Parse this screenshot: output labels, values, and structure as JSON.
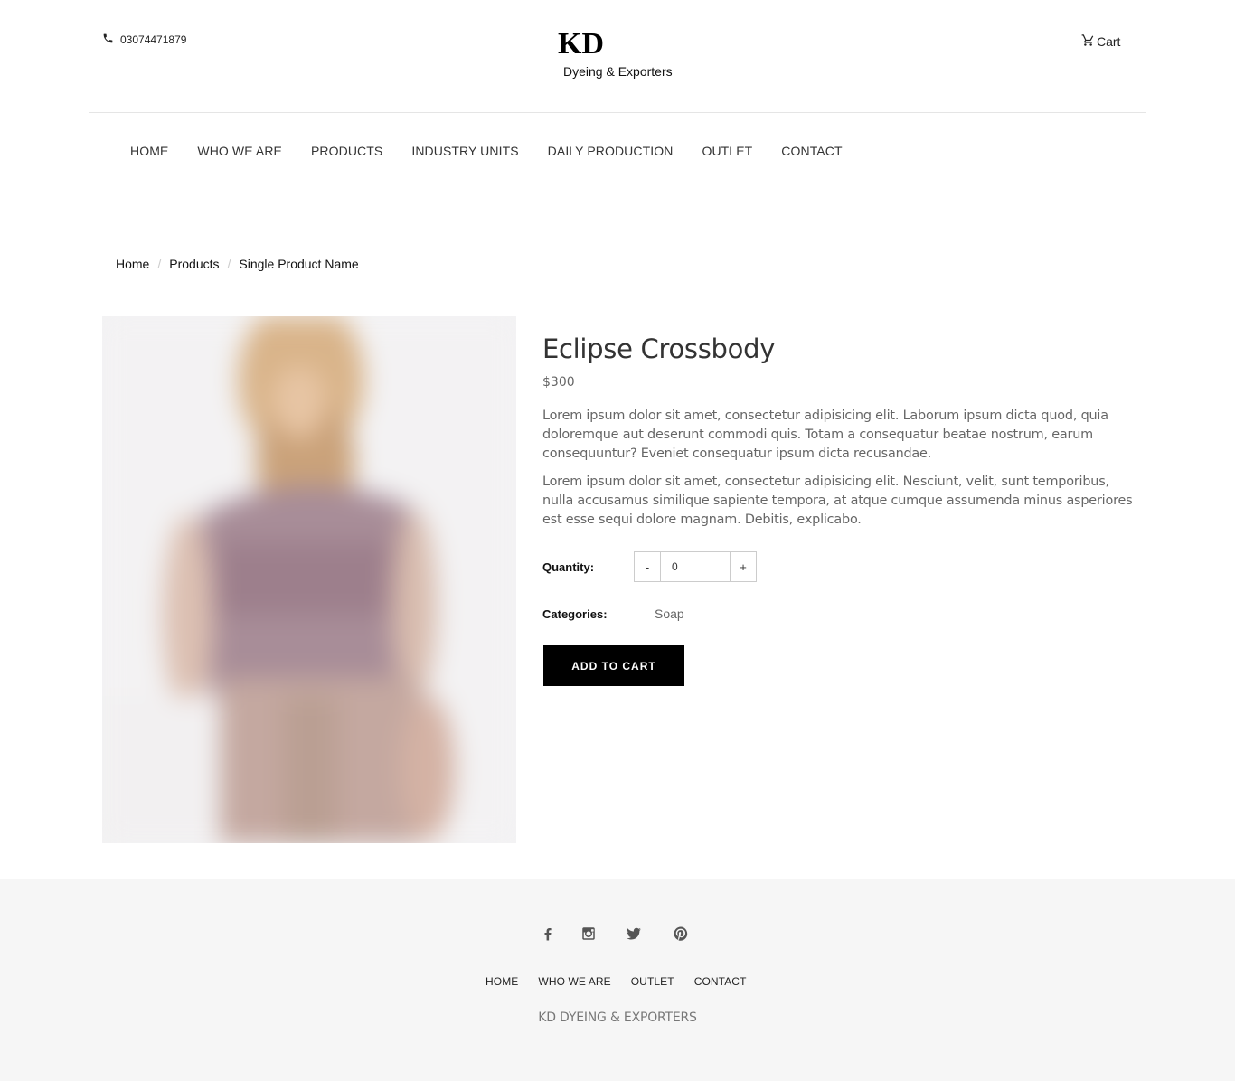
{
  "header": {
    "phone": "03074471879",
    "logo_main": "KD",
    "logo_sub": "Dyeing & Exporters",
    "cart_label": "Cart"
  },
  "nav": {
    "items": [
      "HOME",
      "WHO WE ARE",
      "PRODUCTS",
      "INDUSTRY UNITS",
      "DAILY PRODUCTION",
      "OUTLET",
      "CONTACT"
    ]
  },
  "breadcrumb": {
    "items": [
      "Home",
      "Products",
      "Single Product Name"
    ],
    "separator": "/"
  },
  "product": {
    "image_icon": "product-photo-model-dress",
    "title": "Eclipse Crossbody",
    "price": "$300",
    "description": [
      "Lorem ipsum dolor sit amet, consectetur adipisicing elit. Laborum ipsum dicta quod, quia doloremque aut deserunt commodi quis. Totam a consequatur beatae nostrum, earum consequuntur? Eveniet consequatur ipsum dicta recusandae.",
      "Lorem ipsum dolor sit amet, consectetur adipisicing elit. Nesciunt, velit, sunt temporibus, nulla accusamus similique sapiente tempora, at atque cumque assumenda minus asperiores est esse sequi dolore magnam. Debitis, explicabo."
    ],
    "quantity_label": "Quantity:",
    "quantity_minus": "-",
    "quantity_plus": "+",
    "quantity_value": "0",
    "categories_label": "Categories:",
    "category": "Soap",
    "add_to_cart": "ADD TO CART"
  },
  "footer": {
    "social": [
      "facebook-icon",
      "instagram-icon",
      "twitter-icon",
      "pinterest-icon"
    ],
    "nav": [
      "HOME",
      "WHO WE ARE",
      "OUTLET",
      "CONTACT"
    ],
    "brand": "KD DYEING & EXPORTERS"
  },
  "colors": {
    "footer_bg": "#f6f6f6",
    "button_bg": "#000000",
    "text_muted": "#666666"
  }
}
